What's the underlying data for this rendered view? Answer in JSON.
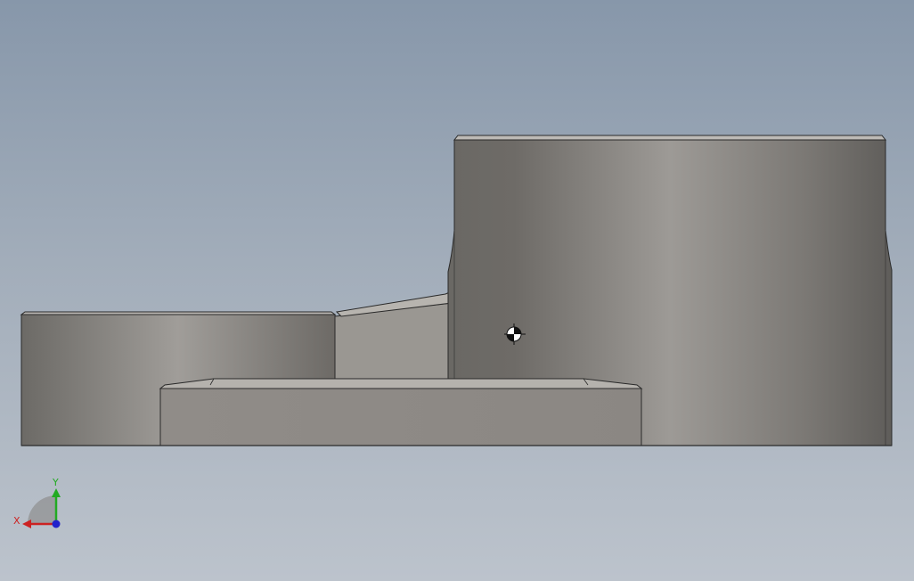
{
  "viewport": {
    "background_top": "#8797aa",
    "background_bottom": "#bcc3cc"
  },
  "model": {
    "part_color": "#8e8a85",
    "edge_color": "#2a2a2a"
  },
  "triad": {
    "x_label": "X",
    "y_label": "Y",
    "x_color": "#cc2222",
    "y_color": "#22aa22",
    "z_color": "#2222cc"
  },
  "origin_marker": {
    "icon": "center-of-mass-icon"
  }
}
